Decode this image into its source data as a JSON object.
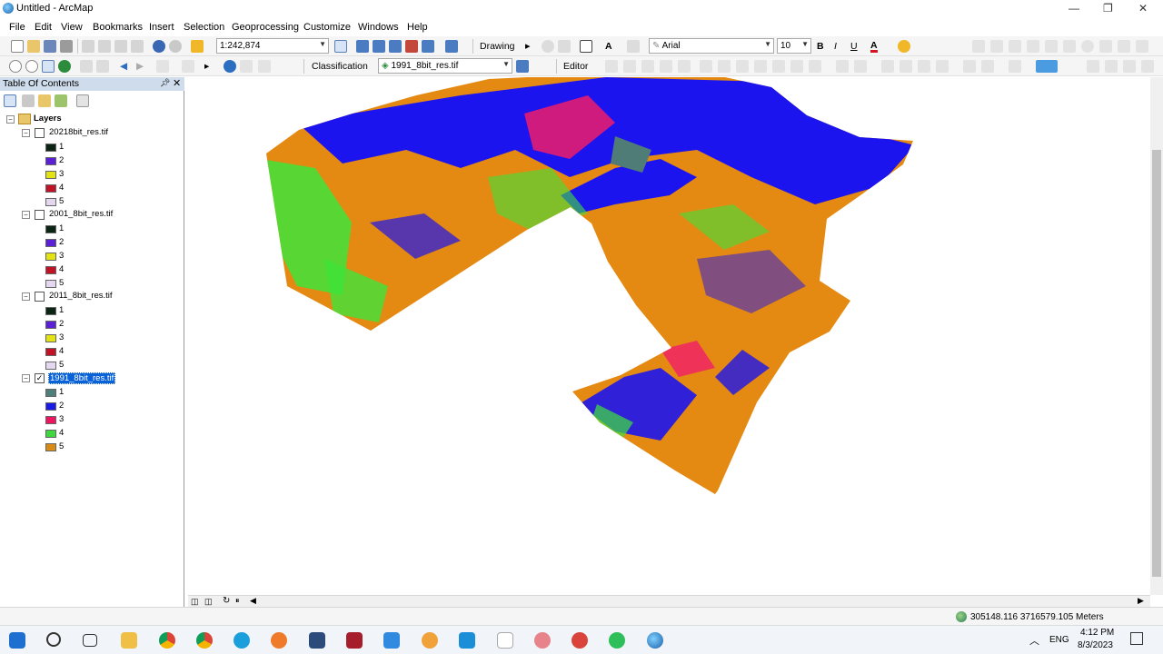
{
  "window": {
    "title": "Untitled - ArcMap"
  },
  "menu": [
    "File",
    "Edit",
    "View",
    "Bookmarks",
    "Insert",
    "Selection",
    "Geoprocessing",
    "Customize",
    "Windows",
    "Help"
  ],
  "toolbar": {
    "scale": "1:242,874",
    "drawing_label": "Drawing",
    "font_name": "Arial",
    "font_size": "10",
    "bold": "B",
    "italic": "I",
    "underline": "U",
    "font_color_glyph": "A",
    "classification_label": "Classification",
    "active_layer": "1991_8bit_res.tif",
    "editor_label": "Editor"
  },
  "toc": {
    "title": "Table Of Contents",
    "root": "Layers",
    "layers": [
      {
        "name": "20218bit_res.tif",
        "checked": false,
        "classes": [
          {
            "label": "1",
            "color": "#0b2414"
          },
          {
            "label": "2",
            "color": "#5b1fd6"
          },
          {
            "label": "3",
            "color": "#e3e313"
          },
          {
            "label": "4",
            "color": "#c21228"
          },
          {
            "label": "5",
            "color": "#e4d8f0"
          }
        ]
      },
      {
        "name": "2001_8bit_res.tif",
        "checked": false,
        "classes": [
          {
            "label": "1",
            "color": "#0b2414"
          },
          {
            "label": "2",
            "color": "#5b1fd6"
          },
          {
            "label": "3",
            "color": "#e3e313"
          },
          {
            "label": "4",
            "color": "#c21228"
          },
          {
            "label": "5",
            "color": "#e4d8f0"
          }
        ]
      },
      {
        "name": "2011_8bit_res.tif",
        "checked": false,
        "classes": [
          {
            "label": "1",
            "color": "#0b2414"
          },
          {
            "label": "2",
            "color": "#5b1fd6"
          },
          {
            "label": "3",
            "color": "#e3e313"
          },
          {
            "label": "4",
            "color": "#c21228"
          },
          {
            "label": "5",
            "color": "#e4d8f0"
          }
        ]
      },
      {
        "name": "1991_8bit_res.tif",
        "checked": true,
        "selected": true,
        "classes": [
          {
            "label": "1",
            "color": "#4e7f78"
          },
          {
            "label": "2",
            "color": "#1a1ae6"
          },
          {
            "label": "3",
            "color": "#ee1460"
          },
          {
            "label": "4",
            "color": "#3ed83e"
          },
          {
            "label": "5",
            "color": "#d98a12"
          }
        ]
      }
    ]
  },
  "map_colors": {
    "water": "#1c14ee",
    "urban": "#e48a12",
    "vegetation": "#3fe33a",
    "built": "#f01c6a",
    "gray": "#4f7c76"
  },
  "status": {
    "coordinates": "305148.116  3716579.105 Meters"
  },
  "taskbar": {
    "lang": "ENG",
    "time": "4:12 PM",
    "date": "8/3/2023"
  }
}
